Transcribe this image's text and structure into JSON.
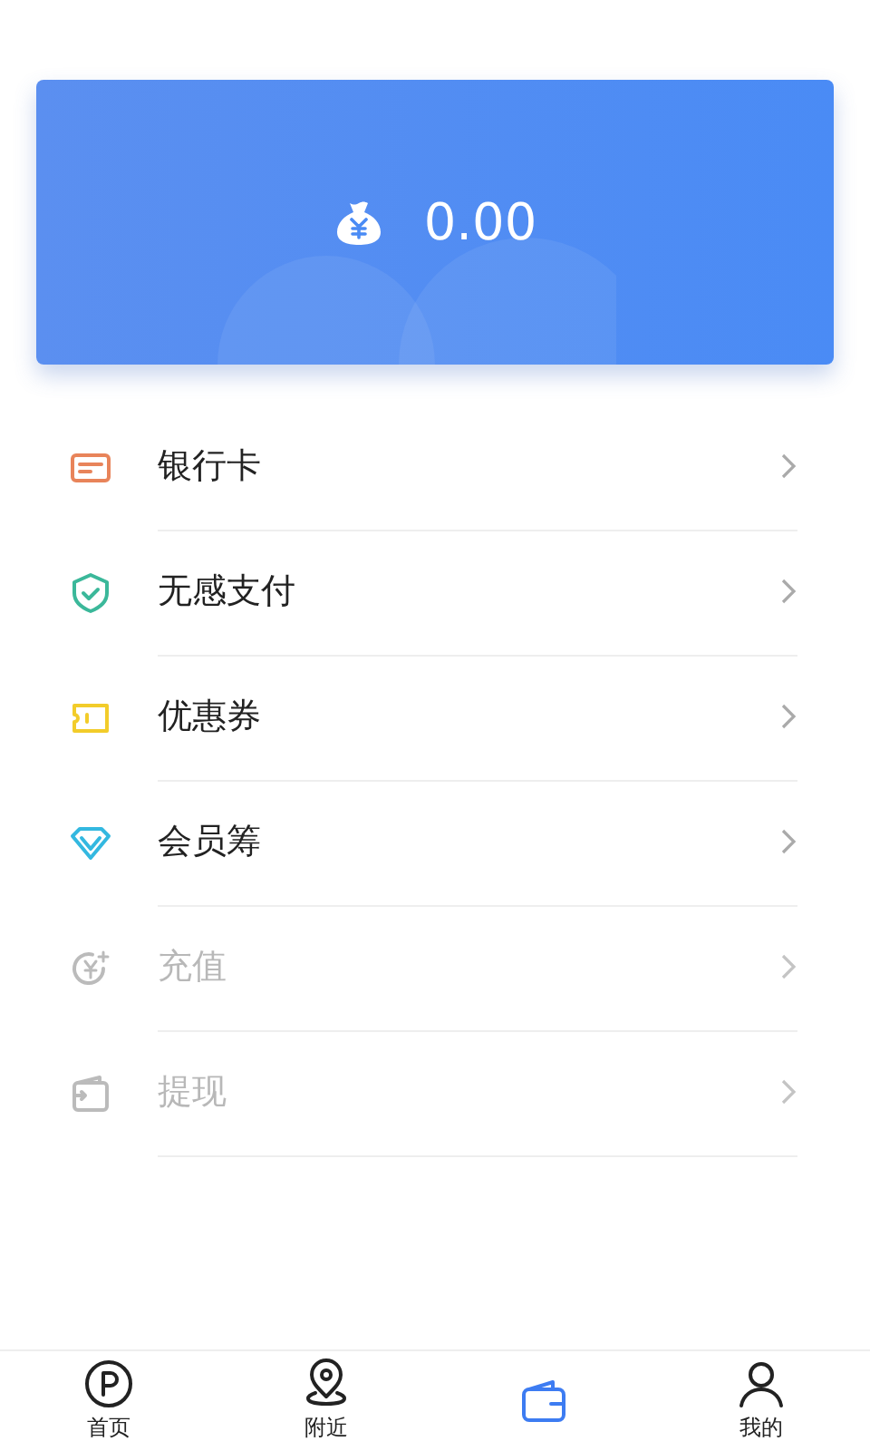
{
  "balance": {
    "amount": "0.00"
  },
  "menu": [
    {
      "kind": "card",
      "label": "银行卡",
      "color": "#e8845a",
      "disabled": false
    },
    {
      "kind": "shield",
      "label": "无感支付",
      "color": "#3bb89a",
      "disabled": false
    },
    {
      "kind": "coupon",
      "label": "优惠券",
      "color": "#f2cc2a",
      "disabled": false
    },
    {
      "kind": "diamond",
      "label": "会员筹",
      "color": "#33b8e0",
      "disabled": false
    },
    {
      "kind": "recharge",
      "label": "充值",
      "color": "#bbbbbb",
      "disabled": true
    },
    {
      "kind": "withdraw",
      "label": "提现",
      "color": "#bbbbbb",
      "disabled": true
    }
  ],
  "tabs": [
    {
      "kind": "parking",
      "label": "首页",
      "selected": false
    },
    {
      "kind": "location",
      "label": "附近",
      "selected": false
    },
    {
      "kind": "wallet",
      "selected": true
    },
    {
      "kind": "person",
      "label": "我的",
      "selected": false
    }
  ]
}
